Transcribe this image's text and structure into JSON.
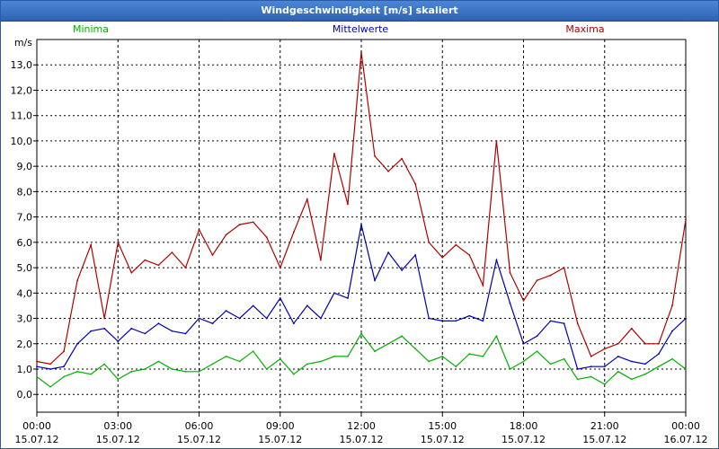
{
  "window": {
    "title": "Windgeschwindigkeit [m/s] skaliert"
  },
  "chart_data": {
    "type": "line",
    "title": "Windgeschwindigkeit [m/s] skaliert",
    "ylabel": "m/s",
    "ylim": [
      -0.7,
      14.0
    ],
    "xlim_hours": [
      0,
      24
    ],
    "y_ticks": [
      "0,0",
      "1,0",
      "2,0",
      "3,0",
      "4,0",
      "5,0",
      "6,0",
      "7,0",
      "8,0",
      "9,0",
      "10,0",
      "11,0",
      "12,0",
      "13,0"
    ],
    "x_ticks": [
      {
        "time": "00:00",
        "date": "15.07.12"
      },
      {
        "time": "03:00",
        "date": "15.07.12"
      },
      {
        "time": "06:00",
        "date": "15.07.12"
      },
      {
        "time": "09:00",
        "date": "15.07.12"
      },
      {
        "time": "12:00",
        "date": "15.07.12"
      },
      {
        "time": "15:00",
        "date": "15.07.12"
      },
      {
        "time": "18:00",
        "date": "15.07.12"
      },
      {
        "time": "21:00",
        "date": "15.07.12"
      },
      {
        "time": "00:00",
        "date": "16.07.12"
      }
    ],
    "grid": true,
    "legend_position": "top",
    "series": [
      {
        "name": "Minima",
        "color": "#00b000",
        "x": [
          0,
          0.5,
          1,
          1.5,
          2,
          2.5,
          3,
          3.5,
          4,
          4.5,
          5,
          5.5,
          6,
          6.5,
          7,
          7.5,
          8,
          8.5,
          9,
          9.5,
          10,
          10.5,
          11,
          11.5,
          12,
          12.5,
          13,
          13.5,
          14,
          14.5,
          15,
          15.5,
          16,
          16.5,
          17,
          17.5,
          18,
          18.5,
          19,
          19.5,
          20,
          20.5,
          21,
          21.5,
          22,
          22.5,
          23,
          23.5,
          24
        ],
        "values": [
          0.7,
          0.3,
          0.7,
          0.9,
          0.8,
          1.2,
          0.6,
          0.9,
          1.0,
          1.3,
          1.0,
          0.9,
          0.9,
          1.2,
          1.5,
          1.3,
          1.7,
          1.0,
          1.4,
          0.8,
          1.2,
          1.3,
          1.5,
          1.5,
          2.4,
          1.7,
          2.0,
          2.3,
          1.8,
          1.3,
          1.5,
          1.1,
          1.6,
          1.5,
          2.3,
          1.0,
          1.3,
          1.7,
          1.2,
          1.4,
          0.6,
          0.7,
          0.4,
          0.9,
          0.6,
          0.8,
          1.1,
          1.4,
          1.0
        ]
      },
      {
        "name": "Mittelwerte",
        "color": "#0000b0",
        "x": [
          0,
          0.5,
          1,
          1.5,
          2,
          2.5,
          3,
          3.5,
          4,
          4.5,
          5,
          5.5,
          6,
          6.5,
          7,
          7.5,
          8,
          8.5,
          9,
          9.5,
          10,
          10.5,
          11,
          11.5,
          12,
          12.5,
          13,
          13.5,
          14,
          14.5,
          15,
          15.5,
          16,
          16.5,
          17,
          17.5,
          18,
          18.5,
          19,
          19.5,
          20,
          20.5,
          21,
          21.5,
          22,
          22.5,
          23,
          23.5,
          24
        ],
        "values": [
          1.1,
          1.0,
          1.1,
          2.0,
          2.5,
          2.6,
          2.1,
          2.6,
          2.4,
          2.8,
          2.5,
          2.4,
          3.0,
          2.8,
          3.3,
          3.0,
          3.5,
          3.0,
          3.8,
          2.8,
          3.5,
          3.0,
          4.0,
          3.8,
          6.7,
          4.5,
          5.6,
          4.9,
          5.5,
          3.0,
          2.9,
          2.9,
          3.1,
          2.9,
          5.3,
          3.6,
          2.0,
          2.3,
          2.9,
          2.8,
          1.0,
          1.1,
          1.1,
          1.5,
          1.3,
          1.2,
          1.6,
          2.5,
          3.0
        ]
      },
      {
        "name": "Maxima",
        "color": "#b00000",
        "x": [
          0,
          0.5,
          1,
          1.5,
          2,
          2.5,
          3,
          3.5,
          4,
          4.5,
          5,
          5.5,
          6,
          6.5,
          7,
          7.5,
          8,
          8.5,
          9,
          9.5,
          10,
          10.5,
          11,
          11.5,
          12,
          12.5,
          13,
          13.5,
          14,
          14.5,
          15,
          15.5,
          16,
          16.5,
          17,
          17.5,
          18,
          18.5,
          19,
          19.5,
          20,
          20.5,
          21,
          21.5,
          22,
          22.5,
          23,
          23.5,
          24
        ],
        "values": [
          1.3,
          1.2,
          1.7,
          4.5,
          5.9,
          3.0,
          6.0,
          4.8,
          5.3,
          5.1,
          5.6,
          5.0,
          6.5,
          5.5,
          6.3,
          6.7,
          6.8,
          6.2,
          5.0,
          6.4,
          7.7,
          5.3,
          9.5,
          7.5,
          13.5,
          9.4,
          8.8,
          9.3,
          8.3,
          6.0,
          5.4,
          5.9,
          5.5,
          4.3,
          10.0,
          4.8,
          3.7,
          4.5,
          4.7,
          5.0,
          2.8,
          1.5,
          1.8,
          2.0,
          2.6,
          2.0,
          2.0,
          3.5,
          6.9
        ]
      }
    ]
  }
}
